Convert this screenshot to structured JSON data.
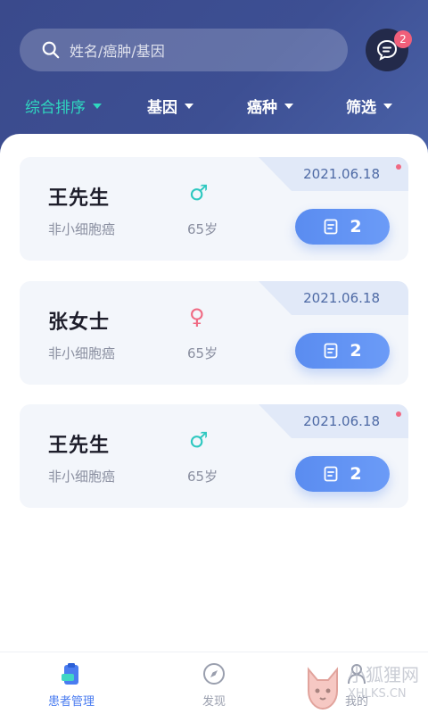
{
  "search": {
    "placeholder": "姓名/癌肿/基因"
  },
  "messages": {
    "badge": "2"
  },
  "filters": [
    {
      "label": "综合排序",
      "active": true
    },
    {
      "label": "基因",
      "active": false
    },
    {
      "label": "癌种",
      "active": false
    },
    {
      "label": "筛选",
      "active": false
    }
  ],
  "patients": [
    {
      "date": "2021.06.18",
      "name": "王先生",
      "gender": "♂",
      "gender_type": "male",
      "diagnosis": "非小细胞癌",
      "age": "65岁",
      "reports": "2",
      "unread": true
    },
    {
      "date": "2021.06.18",
      "name": "张女士",
      "gender": "♀",
      "gender_type": "female",
      "diagnosis": "非小细胞癌",
      "age": "65岁",
      "reports": "2",
      "unread": false
    },
    {
      "date": "2021.06.18",
      "name": "王先生",
      "gender": "♂",
      "gender_type": "male",
      "diagnosis": "非小细胞癌",
      "age": "65岁",
      "reports": "2",
      "unread": true
    }
  ],
  "tabbar": [
    {
      "label": "患者管理",
      "icon": "clipboard-icon",
      "active": true
    },
    {
      "label": "发现",
      "icon": "compass-icon",
      "active": false
    },
    {
      "label": "我的",
      "icon": "person-icon",
      "active": false
    }
  ],
  "watermark": {
    "cn": "小狐狸网",
    "en": "XHLKS.CN"
  },
  "colors": {
    "header": "#3d4f93",
    "accent": "#2fd8c0",
    "button": "#5a8cf0",
    "badge": "#f05f7a"
  }
}
